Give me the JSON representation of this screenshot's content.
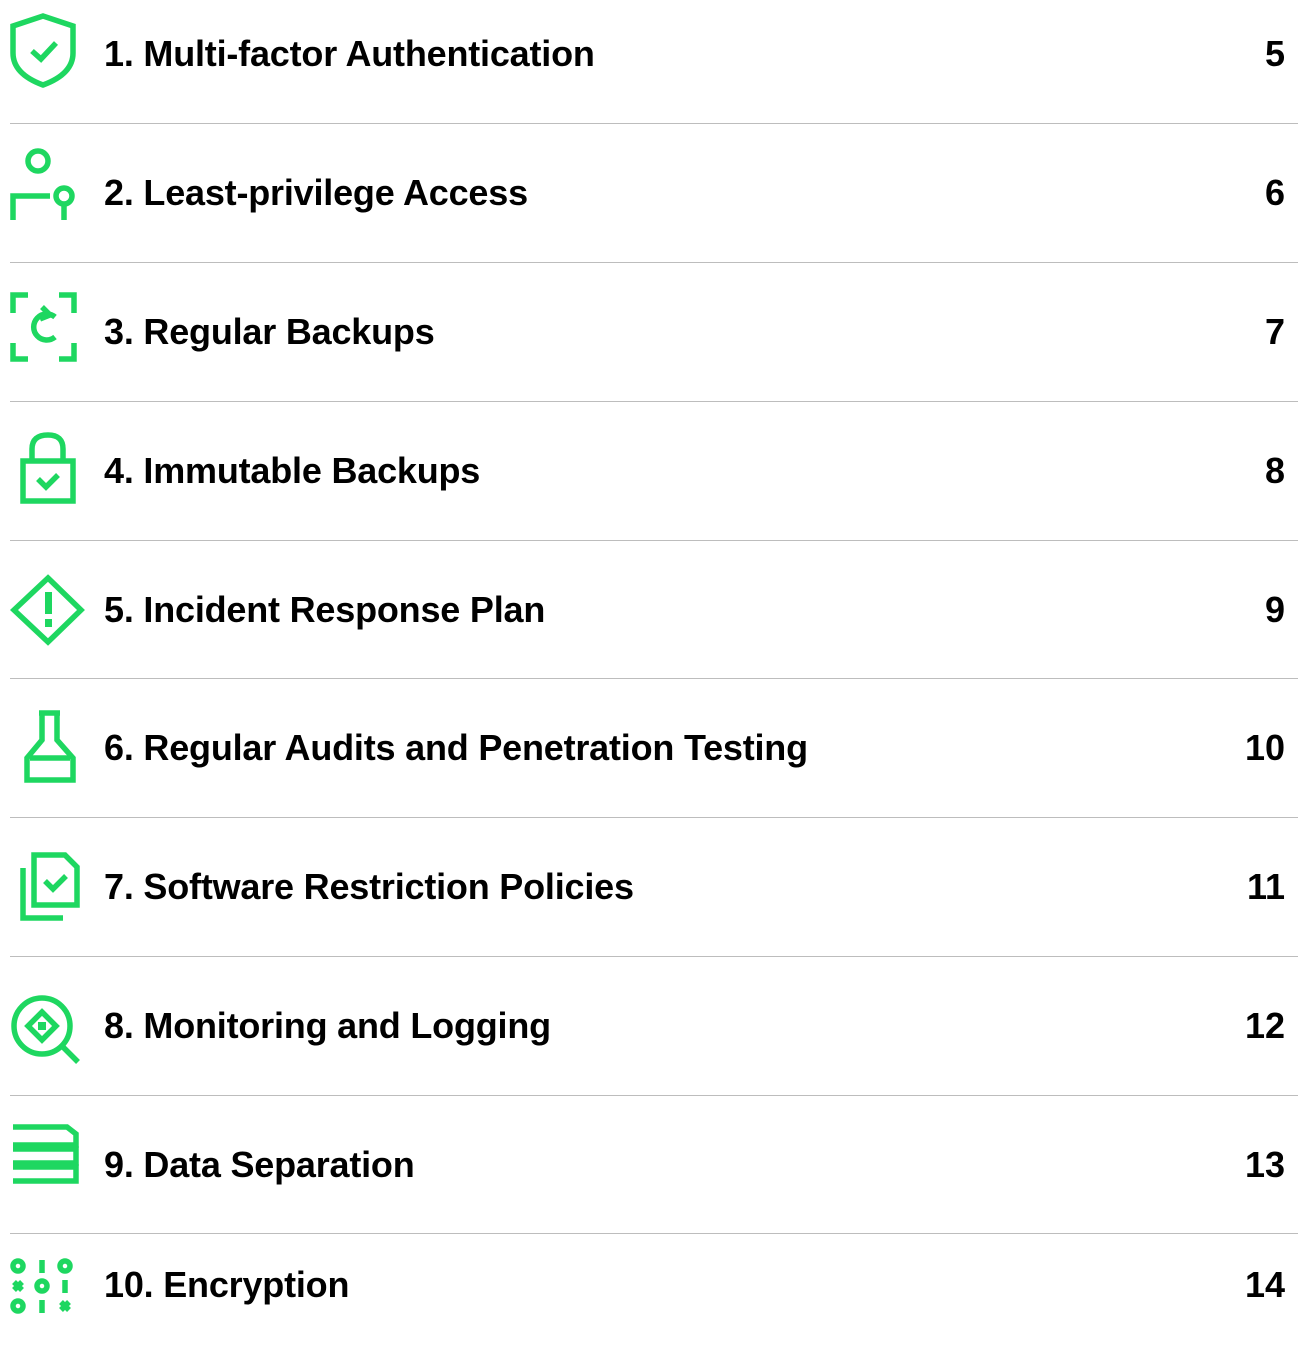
{
  "accent_color": "#1ed760",
  "entries": [
    {
      "title": "1. Multi-factor Authentication",
      "page": "5",
      "icon": "shield-check-icon"
    },
    {
      "title": "2. Least-privilege Access",
      "page": "6",
      "icon": "user-key-icon"
    },
    {
      "title": "3. Regular Backups",
      "page": "7",
      "icon": "refresh-frame-icon"
    },
    {
      "title": "4. Immutable Backups",
      "page": "8",
      "icon": "padlock-check-icon"
    },
    {
      "title": "5. Incident Response Plan",
      "page": "9",
      "icon": "warning-diamond-icon"
    },
    {
      "title": "6. Regular Audits and Penetration Testing",
      "page": "10",
      "icon": "flask-icon"
    },
    {
      "title": "7. Software Restriction Policies",
      "page": "11",
      "icon": "documents-check-icon"
    },
    {
      "title": "8. Monitoring and Logging",
      "page": "12",
      "icon": "search-eye-icon"
    },
    {
      "title": "9. Data Separation",
      "page": "13",
      "icon": "stacked-layers-icon"
    },
    {
      "title": "10. Encryption",
      "page": "14",
      "icon": "binary-code-icon"
    }
  ]
}
